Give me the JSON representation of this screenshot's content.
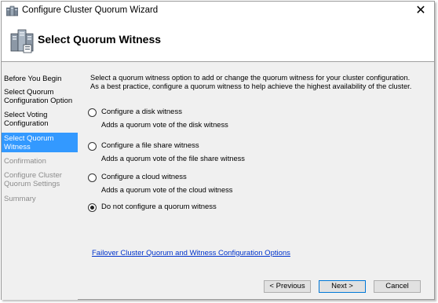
{
  "window": {
    "title": "Configure Cluster Quorum Wizard",
    "close_glyph": "✕"
  },
  "header": {
    "title": "Select Quorum Witness"
  },
  "nav": {
    "items": [
      {
        "label": "Before You Begin",
        "state": "normal"
      },
      {
        "label": "Select Quorum Configuration Option",
        "state": "normal"
      },
      {
        "label": "Select Voting Configuration",
        "state": "normal"
      },
      {
        "label": "Select Quorum Witness",
        "state": "active"
      },
      {
        "label": "Confirmation",
        "state": "disabled"
      },
      {
        "label": "Configure Cluster Quorum Settings",
        "state": "disabled"
      },
      {
        "label": "Summary",
        "state": "disabled"
      }
    ]
  },
  "main": {
    "description": "Select a quorum witness option to add or change the quorum witness for your cluster configuration. As a best practice, configure a quorum witness to help achieve the highest availability of the cluster.",
    "options": [
      {
        "label": "Configure a disk witness",
        "sub": "Adds a quorum vote of the disk witness",
        "checked": false
      },
      {
        "label": "Configure a file share witness",
        "sub": "Adds a quorum vote of the file share witness",
        "checked": false
      },
      {
        "label": "Configure a cloud witness",
        "sub": "Adds a quorum vote of the cloud witness",
        "checked": false
      },
      {
        "label": "Do not configure a quorum witness",
        "sub": "",
        "checked": true
      }
    ],
    "link": "Failover Cluster Quorum and Witness Configuration Options"
  },
  "buttons": {
    "previous": "< Previous",
    "next": "Next >",
    "cancel": "Cancel"
  },
  "colors": {
    "accent": "#3399ff",
    "link": "#0033cc",
    "disabled_text": "#8c8c8c"
  },
  "icons": {
    "title": "cluster-wizard-icon",
    "header": "cluster-servers-icon"
  }
}
